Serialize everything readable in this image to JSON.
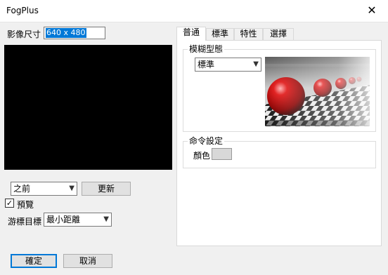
{
  "window": {
    "title": "FogPlus",
    "close_glyph": "✕"
  },
  "image_size": {
    "label": "影像尺寸",
    "value": "640 x 480"
  },
  "controls": {
    "mode_select": "之前",
    "update_button": "更新",
    "preview_checkbox_label": "預覽",
    "preview_checked": true,
    "cursor_target_label": "游標目標",
    "cursor_target_select": "最小距離"
  },
  "tabs": [
    {
      "label": "普通",
      "active": true
    },
    {
      "label": "標準",
      "active": false
    },
    {
      "label": "特性",
      "active": false
    },
    {
      "label": "選擇",
      "active": false
    }
  ],
  "general_tab": {
    "blur_group": {
      "title": "模糊型態",
      "select_value": "標準"
    },
    "command_group": {
      "title": "命令設定",
      "color_label": "顏色",
      "color_value": "#d8d8d8"
    }
  },
  "footer": {
    "ok": "確定",
    "cancel": "取消"
  }
}
